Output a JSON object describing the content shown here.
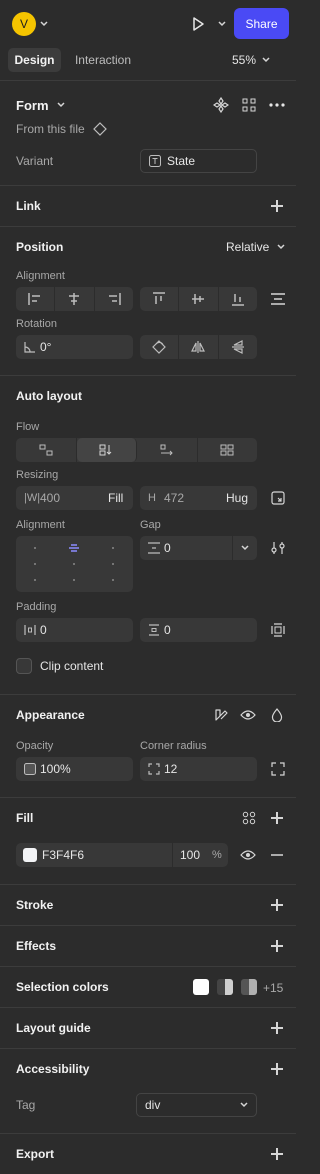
{
  "header": {
    "avatar_letter": "V",
    "share_label": "Share"
  },
  "tabs": {
    "design": "Design",
    "interaction": "Interaction",
    "zoom": "55%"
  },
  "component": {
    "name": "Form",
    "source": "From this file",
    "variant_label": "Variant",
    "variant_value": "State"
  },
  "link": {
    "title": "Link"
  },
  "position": {
    "title": "Position",
    "mode": "Relative",
    "alignment_label": "Alignment",
    "rotation_label": "Rotation",
    "rotation_value": "0°"
  },
  "auto_layout": {
    "title": "Auto layout",
    "flow_label": "Flow",
    "resizing_label": "Resizing",
    "width_prefix": "|W|",
    "width_value": "400",
    "width_mode": "Fill",
    "height_prefix": "H",
    "height_value": "472",
    "height_mode": "Hug",
    "alignment_label": "Alignment",
    "gap_label": "Gap",
    "gap_value": "0",
    "padding_label": "Padding",
    "padding_h": "0",
    "padding_v": "0",
    "clip_label": "Clip content"
  },
  "appearance": {
    "title": "Appearance",
    "opacity_label": "Opacity",
    "opacity_value": "100%",
    "radius_label": "Corner radius",
    "radius_value": "12"
  },
  "fill": {
    "title": "Fill",
    "hex": "F3F4F6",
    "opacity": "100",
    "unit": "%",
    "swatch_color": "#F3F4F6"
  },
  "stroke": {
    "title": "Stroke"
  },
  "effects": {
    "title": "Effects"
  },
  "selection_colors": {
    "title": "Selection colors",
    "more": "+15"
  },
  "layout_guide": {
    "title": "Layout guide"
  },
  "accessibility": {
    "title": "Accessibility",
    "tag_label": "Tag",
    "tag_value": "div"
  },
  "export": {
    "title": "Export"
  },
  "colors": {
    "accent": "#4a4af5",
    "avatar": "#f5c400",
    "bg": "#2c2c2c"
  }
}
